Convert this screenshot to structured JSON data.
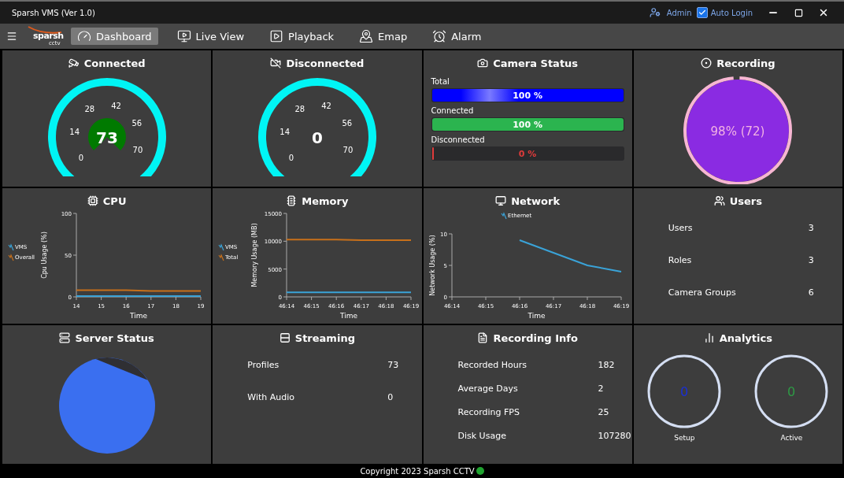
{
  "window": {
    "title": "Sparsh VMS (Ver 1.0)",
    "user": "Admin",
    "auto_login": {
      "label": "Auto Login",
      "checked": true
    }
  },
  "logo": {
    "name": "sparsh",
    "sub": "cctv"
  },
  "nav": [
    {
      "label": "Dashboard",
      "selected": true
    },
    {
      "label": "Live View",
      "selected": false
    },
    {
      "label": "Playback",
      "selected": false
    },
    {
      "label": "Emap",
      "selected": false
    },
    {
      "label": "Alarm",
      "selected": false
    }
  ],
  "cards": [
    {
      "kind": "gauge",
      "title": "Connected",
      "value": "73",
      "highlight": true,
      "ticks": [
        "0",
        "14",
        "28",
        "42",
        "56",
        "70"
      ]
    },
    {
      "kind": "gauge",
      "title": "Disconnected",
      "value": "0",
      "highlight": false,
      "ticks": [
        "0",
        "14",
        "28",
        "42",
        "56",
        "70"
      ]
    },
    {
      "kind": "bars",
      "title": "Camera Status",
      "bars": [
        {
          "label": "Total",
          "reading": "100 %",
          "level": 1,
          "color": "#0000ff"
        },
        {
          "label": "Connected",
          "reading": "100 %",
          "level": 1,
          "color": "#2bb44f"
        },
        {
          "label": "Disconnected",
          "reading": "0 %",
          "level": 0,
          "color": "#e03b3b"
        }
      ]
    },
    {
      "kind": "donut",
      "title": "Recording",
      "reading": "98% (72)",
      "level": 0.98
    },
    {
      "kind": "line-chart",
      "title": "CPU",
      "chart_data": {
        "type": "line",
        "xlabel": "Time",
        "ylabel": "Cpu Usage (%)",
        "x": [
          14,
          15,
          16,
          17,
          18,
          19
        ],
        "xlim": [
          14,
          19
        ],
        "ylim": [
          0,
          100
        ],
        "xticks": [
          14,
          15,
          16,
          17,
          18,
          19
        ],
        "yticks": [
          0,
          50,
          100
        ],
        "legend": true,
        "series": [
          {
            "name": "VMS",
            "color": "#3aa3d8",
            "values": [
              1,
              1,
              1,
              1,
              1,
              1
            ]
          },
          {
            "name": "Overall",
            "color": "#c8701a",
            "values": [
              8,
              8,
              8,
              7,
              7,
              7
            ]
          }
        ]
      }
    },
    {
      "kind": "line-chart",
      "title": "Memory",
      "chart_data": {
        "type": "line",
        "xlabel": "Time",
        "ylabel": "Memory Usage (MB)",
        "categories": [
          "46:14",
          "46:15",
          "46:16",
          "46:17",
          "46:18",
          "46:19"
        ],
        "ylim": [
          0,
          15000
        ],
        "yticks": [
          0,
          5000,
          10000,
          15000
        ],
        "legend": true,
        "series": [
          {
            "name": "VMS",
            "color": "#3aa3d8",
            "values": [
              800,
              800,
              800,
              800,
              800,
              800
            ]
          },
          {
            "name": "Total",
            "color": "#c8701a",
            "values": [
              10300,
              10300,
              10300,
              10200,
              10200,
              10200
            ]
          }
        ]
      }
    },
    {
      "kind": "line-chart",
      "title": "Network",
      "chart_data": {
        "type": "line",
        "xlabel": "Time",
        "ylabel": "Network Usage (%)",
        "categories": [
          "46:14",
          "46:15",
          "46:16",
          "46:17",
          "46:18",
          "46:19"
        ],
        "ylim": [
          0,
          10
        ],
        "yticks": [
          0,
          5,
          10
        ],
        "legend": true,
        "series": [
          {
            "name": "Ethernet",
            "color": "#3aa3d8",
            "values": [
              null,
              null,
              9,
              7,
              5,
              4
            ]
          }
        ]
      }
    },
    {
      "kind": "stats",
      "title": "Users",
      "rows": [
        {
          "label": "Users",
          "value": "3"
        },
        {
          "label": "Roles",
          "value": "3"
        },
        {
          "label": "Camera Groups",
          "value": "6"
        }
      ]
    },
    {
      "kind": "pie",
      "title": "Server Status"
    },
    {
      "kind": "stats",
      "title": "Streaming",
      "rows": [
        {
          "label": "Profiles",
          "value": "73"
        },
        {
          "label": "With Audio",
          "value": "0"
        }
      ]
    },
    {
      "kind": "stats",
      "title": "Recording Info",
      "rows": [
        {
          "label": "Recorded Hours",
          "value": "182"
        },
        {
          "label": "Average Days",
          "value": "2"
        },
        {
          "label": "Recording FPS",
          "value": "25"
        },
        {
          "label": "Disk Usage",
          "value": "107280"
        }
      ]
    },
    {
      "kind": "rings",
      "title": "Analytics",
      "rings": [
        {
          "value": "0",
          "label": "Setup",
          "color": "#1a2fd6"
        },
        {
          "value": "0",
          "label": "Active",
          "color": "#2e9a45"
        }
      ]
    }
  ],
  "footer": "Copyright 2023 Sparsh CCTV"
}
